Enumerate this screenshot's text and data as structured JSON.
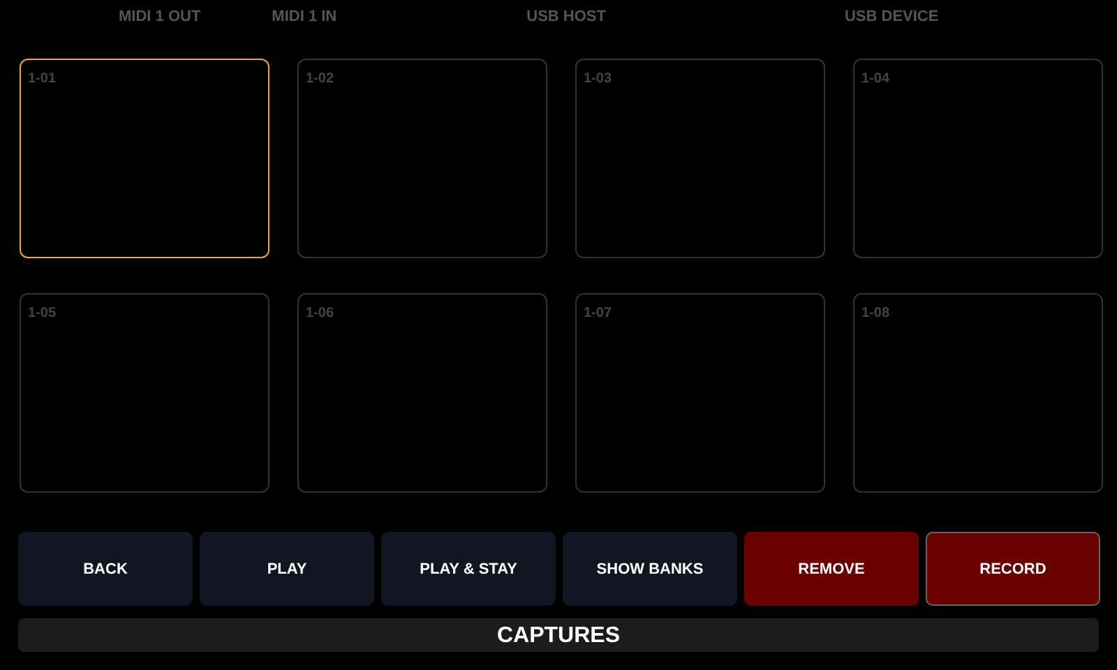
{
  "port_labels": [
    "MIDI 1 OUT",
    "MIDI 1 IN",
    "USB HOST",
    "USB DEVICE"
  ],
  "slots": [
    {
      "label": "1-01",
      "selected": true
    },
    {
      "label": "1-02",
      "selected": false
    },
    {
      "label": "1-03",
      "selected": false
    },
    {
      "label": "1-04",
      "selected": false
    },
    {
      "label": "1-05",
      "selected": false
    },
    {
      "label": "1-06",
      "selected": false
    },
    {
      "label": "1-07",
      "selected": false
    },
    {
      "label": "1-08",
      "selected": false
    }
  ],
  "buttons": [
    {
      "label": "BACK",
      "kind": "normal",
      "selected": false
    },
    {
      "label": "PLAY",
      "kind": "normal",
      "selected": false
    },
    {
      "label": "PLAY & STAY",
      "kind": "normal",
      "selected": false
    },
    {
      "label": "SHOW BANKS",
      "kind": "normal",
      "selected": false
    },
    {
      "label": "REMOVE",
      "kind": "danger",
      "selected": false
    },
    {
      "label": "RECORD",
      "kind": "danger",
      "selected": true
    }
  ],
  "title": "CAPTURES"
}
